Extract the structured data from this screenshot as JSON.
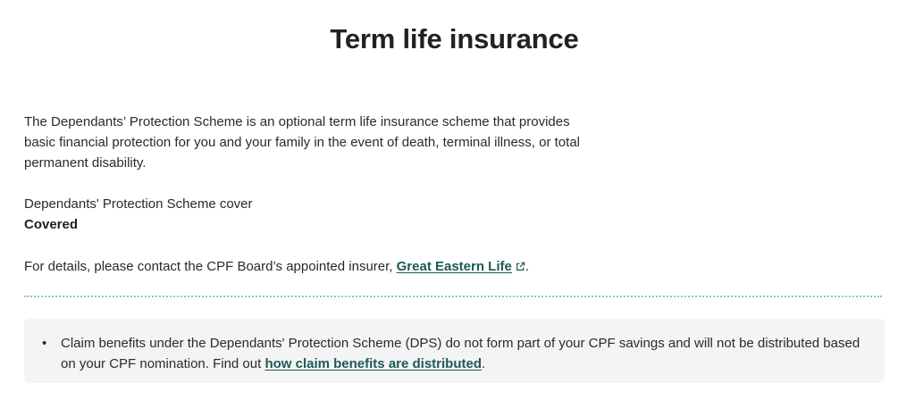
{
  "page": {
    "title": "Term life insurance"
  },
  "intro": {
    "text": "The Dependants’ Protection Scheme is an optional term life insurance scheme that provides basic financial protection for you and your family in the event of death, terminal illness, or total permanent disability."
  },
  "cover": {
    "label": "Dependants' Protection Scheme cover",
    "value": "Covered"
  },
  "details": {
    "prefix": "For details, please contact the CPF Board’s appointed insurer, ",
    "link_label": "Great Eastern Life",
    "link_icon": "external-link-icon",
    "suffix": "."
  },
  "note": {
    "bullet": "•",
    "prefix": "Claim benefits under the Dependants' Protection Scheme (DPS) do not form part of your CPF savings and will not be distributed based on your CPF nomination. Find out ",
    "link_label": "how claim benefits are distributed",
    "suffix": "."
  },
  "colors": {
    "link": "#1d5a55",
    "divider": "#8fc7bd",
    "note_background": "#f4f4f4"
  }
}
